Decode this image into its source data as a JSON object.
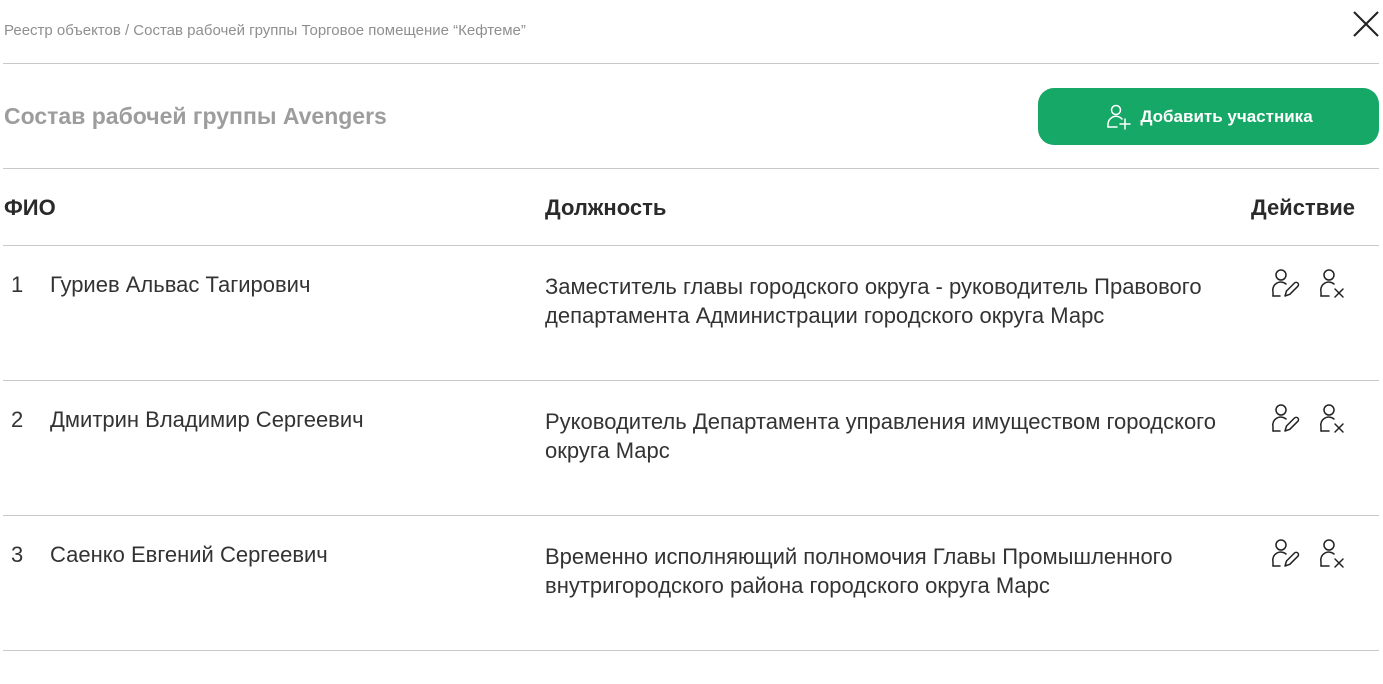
{
  "breadcrumb": "Реестр объектов / Состав рабочей группы Торговое помещение “Кефтеме”",
  "title": "Состав рабочей группы Avengers",
  "add_button": {
    "label": "Добавить участника",
    "icon": "user-plus-icon",
    "color": "#16a866"
  },
  "columns": {
    "name": "ФИО",
    "position": "Должность",
    "action": "Действие"
  },
  "rows": [
    {
      "num": "1",
      "name": "Гуриев Альвас Тагирович",
      "position": "Заместитель главы городского округа - руководитель Правового департамента Администрации городского округа Марс"
    },
    {
      "num": "2",
      "name": "Дмитрин Владимир Сергеевич",
      "position": "Руководитель Департамента управления имуществом городского округа Марс"
    },
    {
      "num": "3",
      "name": "Саенко Евгений Сергеевич",
      "position": "Временно исполняющий полномочия Главы Промышленного внутригородского района городского округа Марс"
    }
  ],
  "row_actions": {
    "edit_icon": "user-edit-icon",
    "remove_icon": "user-remove-icon"
  },
  "close_icon": "close-icon"
}
